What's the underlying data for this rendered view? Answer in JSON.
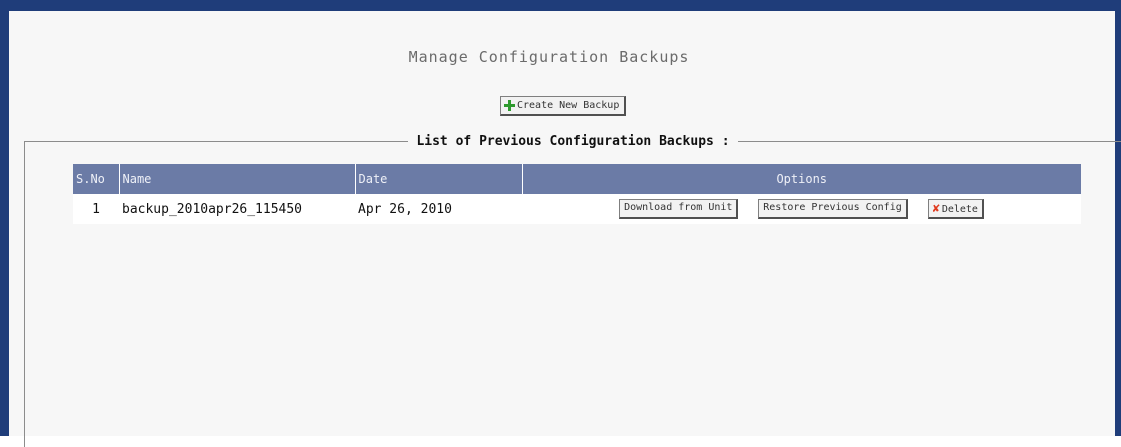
{
  "page": {
    "title": "Manage Configuration Backups"
  },
  "toolbar": {
    "create_label": "Create New Backup",
    "create_icon": "plus-icon"
  },
  "backups_section": {
    "legend": "List of Previous Configuration Backups :",
    "columns": {
      "sno": "S.No",
      "name": "Name",
      "date": "Date",
      "options": "Options"
    },
    "rows": [
      {
        "sno": "1",
        "name": "backup_2010apr26_115450",
        "date": "Apr 26, 2010",
        "actions": {
          "download": "Download from Unit",
          "restore": "Restore Previous Config",
          "delete": "Delete",
          "delete_icon": "close-icon"
        }
      }
    ]
  },
  "colors": {
    "frame": "#1f3d7a",
    "table_header": "#6b7ba6",
    "add_icon": "#2e9a2e",
    "delete_icon": "#e03a1e"
  }
}
